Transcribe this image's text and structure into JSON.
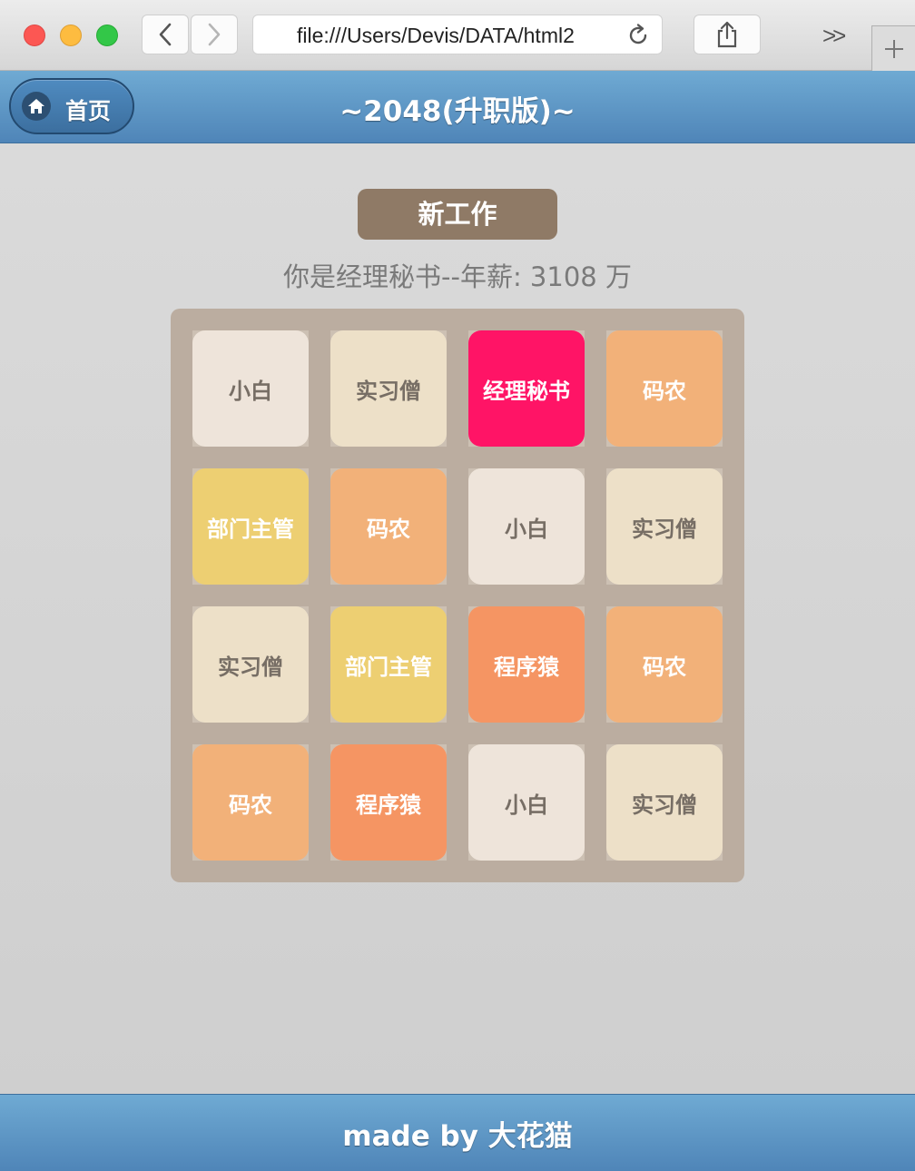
{
  "browser": {
    "url": "file:///Users/Devis/DATA/html2",
    "more_label": ">>"
  },
  "header": {
    "home_label": "首页",
    "title": "~2048(升职版)~"
  },
  "game": {
    "new_game_label": "新工作",
    "status_text": "你是经理秘书--年薪: 3108 万",
    "tiles": [
      {
        "label": "小白",
        "bg": "#eee4da",
        "color": "#776e65"
      },
      {
        "label": "实习僧",
        "bg": "#ede0c8",
        "color": "#776e65"
      },
      {
        "label": "经理秘书",
        "bg": "#ff1466",
        "color": "#ffffff"
      },
      {
        "label": "码农",
        "bg": "#f2b179",
        "color": "#ffffff"
      },
      {
        "label": "部门主管",
        "bg": "#edcf72",
        "color": "#ffffff"
      },
      {
        "label": "码农",
        "bg": "#f2b179",
        "color": "#ffffff"
      },
      {
        "label": "小白",
        "bg": "#eee4da",
        "color": "#776e65"
      },
      {
        "label": "实习僧",
        "bg": "#ede0c8",
        "color": "#776e65"
      },
      {
        "label": "实习僧",
        "bg": "#ede0c8",
        "color": "#776e65"
      },
      {
        "label": "部门主管",
        "bg": "#edcf72",
        "color": "#ffffff"
      },
      {
        "label": "程序猿",
        "bg": "#f59563",
        "color": "#ffffff"
      },
      {
        "label": "码农",
        "bg": "#f2b179",
        "color": "#ffffff"
      },
      {
        "label": "码农",
        "bg": "#f2b179",
        "color": "#ffffff"
      },
      {
        "label": "程序猿",
        "bg": "#f59563",
        "color": "#ffffff"
      },
      {
        "label": "小白",
        "bg": "#eee4da",
        "color": "#776e65"
      },
      {
        "label": "实习僧",
        "bg": "#ede0c8",
        "color": "#776e65"
      }
    ]
  },
  "footer": {
    "text": "made by 大花猫"
  },
  "colors": {
    "header_blue": "#5b95c6",
    "board": "#bbada0",
    "button_brown": "#8f7a66"
  }
}
